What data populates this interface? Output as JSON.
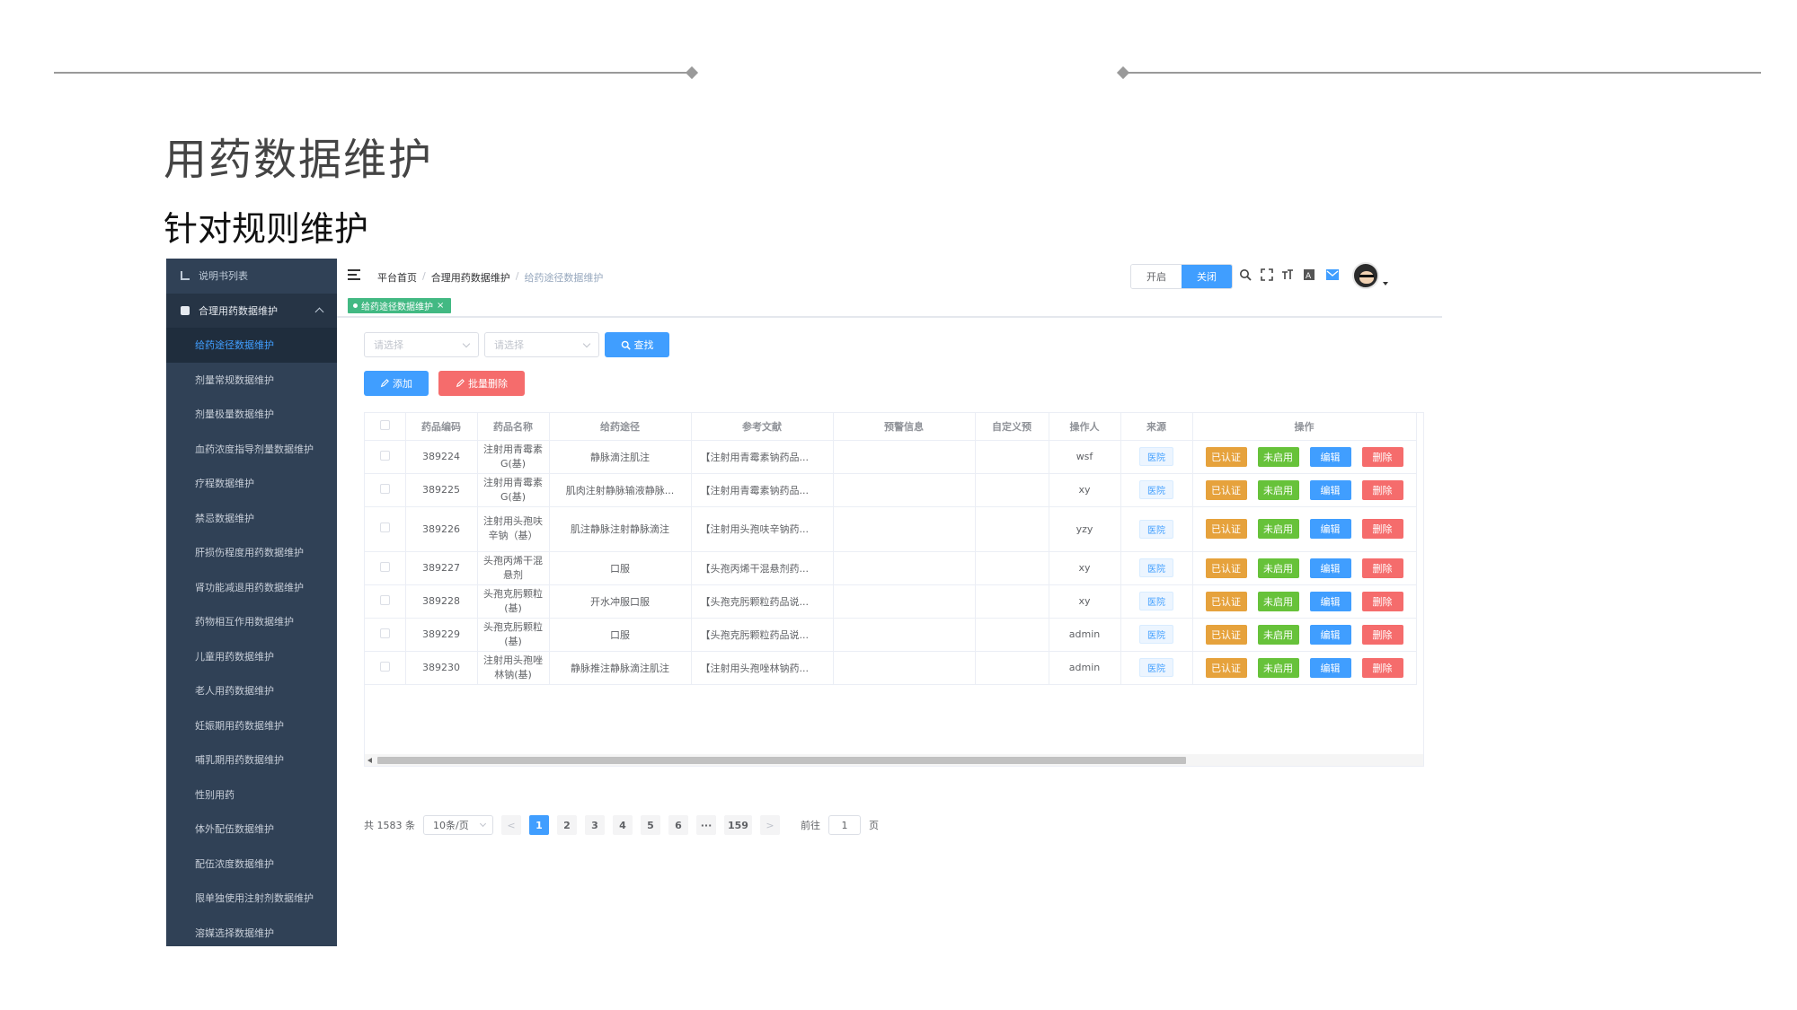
{
  "slide": {
    "title": "用药数据维护",
    "subtitle": "针对规则维护"
  },
  "sidebar": {
    "top_item": "说明书列表",
    "group_label": "合理用药数据维护",
    "items": [
      {
        "label": "给药途径数据维护",
        "active": true
      },
      {
        "label": "剂量常规数据维护"
      },
      {
        "label": "剂量极量数据维护"
      },
      {
        "label": "血药浓度指导剂量数据维护"
      },
      {
        "label": "疗程数据维护"
      },
      {
        "label": "禁忌数据维护"
      },
      {
        "label": "肝损伤程度用药数据维护"
      },
      {
        "label": "肾功能减退用药数据维护"
      },
      {
        "label": "药物相互作用数据维护"
      },
      {
        "label": "儿童用药数据维护"
      },
      {
        "label": "老人用药数据维护"
      },
      {
        "label": "妊娠期用药数据维护"
      },
      {
        "label": "哺乳期用药数据维护"
      },
      {
        "label": "性别用药"
      },
      {
        "label": "体外配伍数据维护"
      },
      {
        "label": "配伍浓度数据维护"
      },
      {
        "label": "限单独使用注射剂数据维护"
      },
      {
        "label": "溶媒选择数据维护"
      }
    ]
  },
  "navbar": {
    "breadcrumb": [
      "平台首页",
      "合理用药数据维护",
      "给药途径数据维护"
    ],
    "toggle_on": "开启",
    "toggle_off": "关闭",
    "icons": [
      "search-icon",
      "fullscreen-icon",
      "font-size-icon",
      "translate-icon",
      "mail-icon"
    ]
  },
  "tags": {
    "active": "给药途径数据维护",
    "close": "×"
  },
  "filters": {
    "select1_placeholder": "请选择",
    "select2_placeholder": "请选择",
    "search_label": "查找"
  },
  "toolbar": {
    "add_label": "添加",
    "batch_delete_label": "批量删除"
  },
  "table": {
    "columns": [
      "",
      "药品编码",
      "药品名称",
      "给药途径",
      "参考文献",
      "预警信息",
      "自定义预",
      "操作人",
      "来源",
      "操作"
    ],
    "source_tag": "医院",
    "op_labels": [
      "已认证",
      "未启用",
      "编辑",
      "删除"
    ],
    "rows": [
      {
        "code": "389224",
        "name": "注射用青霉素G(基)",
        "route": "静脉滴注肌注",
        "ref": "【注射用青霉素钠药品...",
        "warn": "",
        "custom": "",
        "operator": "wsf"
      },
      {
        "code": "389225",
        "name": "注射用青霉素G(基)",
        "route": "肌肉注射静脉输液静脉...",
        "ref": "【注射用青霉素钠药品...",
        "warn": "",
        "custom": "",
        "operator": "xy"
      },
      {
        "code": "389226",
        "name": "注射用头孢呋辛钠（基）",
        "route": "肌注静脉注射静脉滴注",
        "ref": "【注射用头孢呋辛钠药...",
        "warn": "",
        "custom": "",
        "operator": "yzy"
      },
      {
        "code": "389227",
        "name": "头孢丙烯干混悬剂",
        "route": "口服",
        "ref": "【头孢丙烯干混悬剂药...",
        "warn": "",
        "custom": "",
        "operator": "xy"
      },
      {
        "code": "389228",
        "name": "头孢克肟颗粒(基)",
        "route": "开水冲服口服",
        "ref": "【头孢克肟颗粒药品说...",
        "warn": "",
        "custom": "",
        "operator": "xy"
      },
      {
        "code": "389229",
        "name": "头孢克肟颗粒(基)",
        "route": "口服",
        "ref": "【头孢克肟颗粒药品说...",
        "warn": "",
        "custom": "",
        "operator": "admin"
      },
      {
        "code": "389230",
        "name": "注射用头孢唑林钠(基)",
        "route": "静脉推注静脉滴注肌注",
        "ref": "【注射用头孢唑林钠药...",
        "warn": "",
        "custom": "",
        "operator": "admin"
      }
    ]
  },
  "pagination": {
    "total": "共 1583 条",
    "page_size": "10条/页",
    "prev": "<",
    "pages": [
      "1",
      "2",
      "3",
      "4",
      "5",
      "6",
      "···",
      "159"
    ],
    "current": "1",
    "next": ">",
    "goto_label": "前往",
    "goto_value": "1",
    "page_unit": "页"
  },
  "colors": {
    "sidebar_bg": "#304156",
    "primary": "#409eff",
    "success": "#67c23a",
    "warning": "#e6a23c",
    "danger": "#f56c6c",
    "tag_active": "#42b983"
  }
}
